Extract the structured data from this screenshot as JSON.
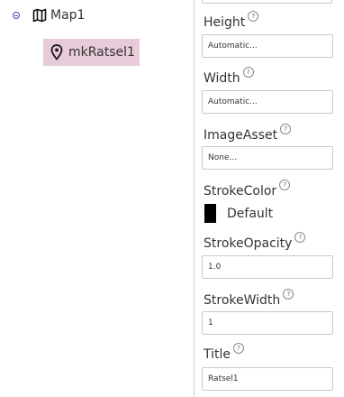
{
  "tree": {
    "map_label": "Map1",
    "marker_label": "mkRatsel1",
    "map_icon": "map-icon",
    "marker_icon": "location-pin-icon",
    "collapse_icon": "collapse-minus-icon",
    "selected_color": "#e8cbd9"
  },
  "properties": {
    "help_glyph": "?",
    "height": {
      "label": "Height",
      "value": "Automatic..."
    },
    "width": {
      "label": "Width",
      "value": "Automatic..."
    },
    "image_asset": {
      "label": "ImageAsset",
      "value": "None..."
    },
    "stroke_color": {
      "label": "StrokeColor",
      "value": "Default",
      "swatch_color": "#000000"
    },
    "stroke_opacity": {
      "label": "StrokeOpacity",
      "value": "1.0"
    },
    "stroke_width": {
      "label": "StrokeWidth",
      "value": "1"
    },
    "title": {
      "label": "Title",
      "value": "Ratsel1"
    }
  }
}
